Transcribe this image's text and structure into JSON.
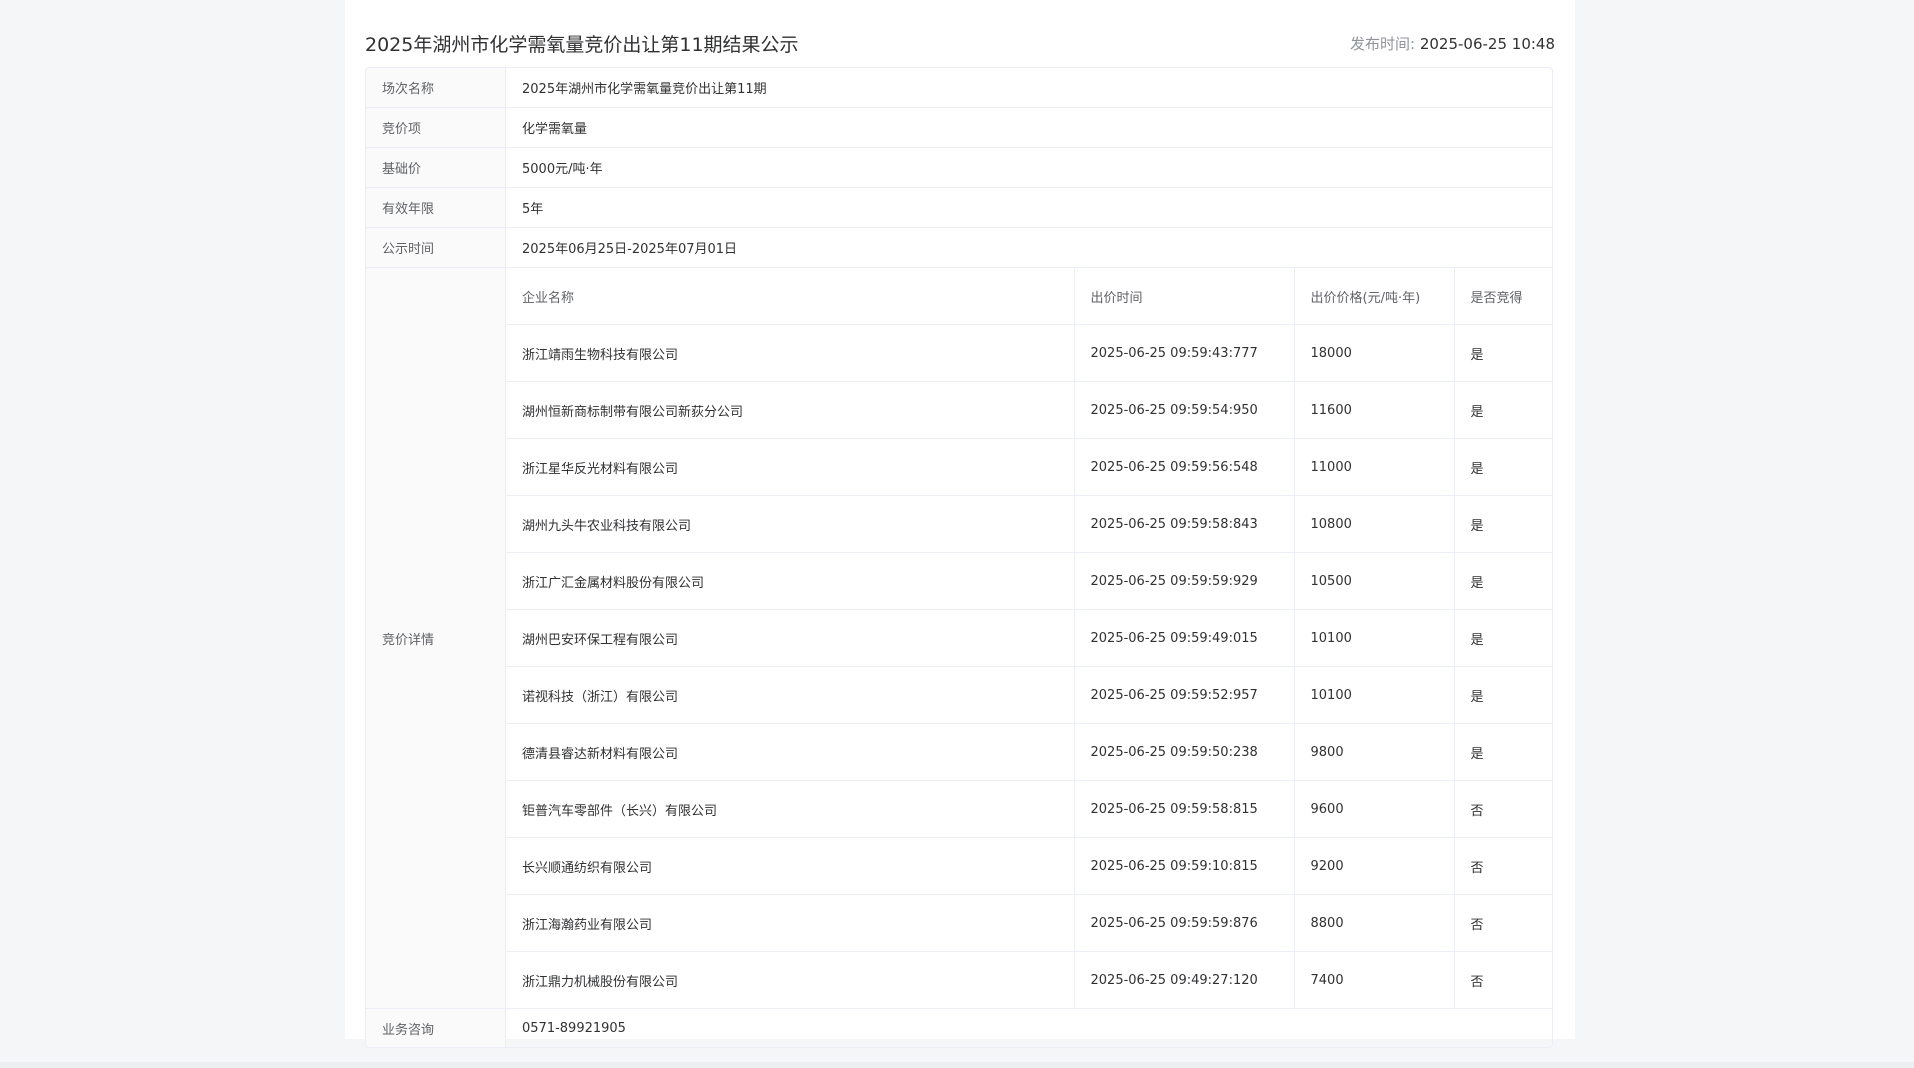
{
  "header": {
    "title": "2025年湖州市化学需氧量竞价出让第11期结果公示",
    "publish_label": "发布时间: ",
    "publish_time": "2025-06-25 10:48"
  },
  "info": {
    "session_label": "场次名称",
    "session_value": "2025年湖州市化学需氧量竞价出让第11期",
    "item_label": "竞价项",
    "item_value": "化学需氧量",
    "base_price_label": "基础价",
    "base_price_value": "5000元/吨·年",
    "validity_label": "有效年限",
    "validity_value": "5年",
    "notice_label": "公示时间",
    "notice_value": "2025年06月25日-2025年07月01日",
    "detail_label": "竞价详情",
    "consult_label": "业务咨询",
    "consult_value": "0571-89921905"
  },
  "bid_table": {
    "headers": [
      "企业名称",
      "出价时间",
      "出价价格(元/吨·年)",
      "是否竞得"
    ],
    "rows": [
      [
        "浙江靖雨生物科技有限公司",
        "2025-06-25 09:59:43:777",
        "18000",
        "是"
      ],
      [
        "湖州恒新商标制带有限公司新荻分公司",
        "2025-06-25 09:59:54:950",
        "11600",
        "是"
      ],
      [
        "浙江星华反光材料有限公司",
        "2025-06-25 09:59:56:548",
        "11000",
        "是"
      ],
      [
        "湖州九头牛农业科技有限公司",
        "2025-06-25 09:59:58:843",
        "10800",
        "是"
      ],
      [
        "浙江广汇金属材料股份有限公司",
        "2025-06-25 09:59:59:929",
        "10500",
        "是"
      ],
      [
        "湖州巴安环保工程有限公司",
        "2025-06-25 09:59:49:015",
        "10100",
        "是"
      ],
      [
        "诺视科技（浙江）有限公司",
        "2025-06-25 09:59:52:957",
        "10100",
        "是"
      ],
      [
        "德清县睿达新材料有限公司",
        "2025-06-25 09:59:50:238",
        "9800",
        "是"
      ],
      [
        "钜普汽车零部件（长兴）有限公司",
        "2025-06-25 09:59:58:815",
        "9600",
        "否"
      ],
      [
        "长兴顺通纺织有限公司",
        "2025-06-25 09:59:10:815",
        "9200",
        "否"
      ],
      [
        "浙江海瀚药业有限公司",
        "2025-06-25 09:59:59:876",
        "8800",
        "否"
      ],
      [
        "浙江鼎力机械股份有限公司",
        "2025-06-25 09:49:27:120",
        "7400",
        "否"
      ]
    ]
  }
}
